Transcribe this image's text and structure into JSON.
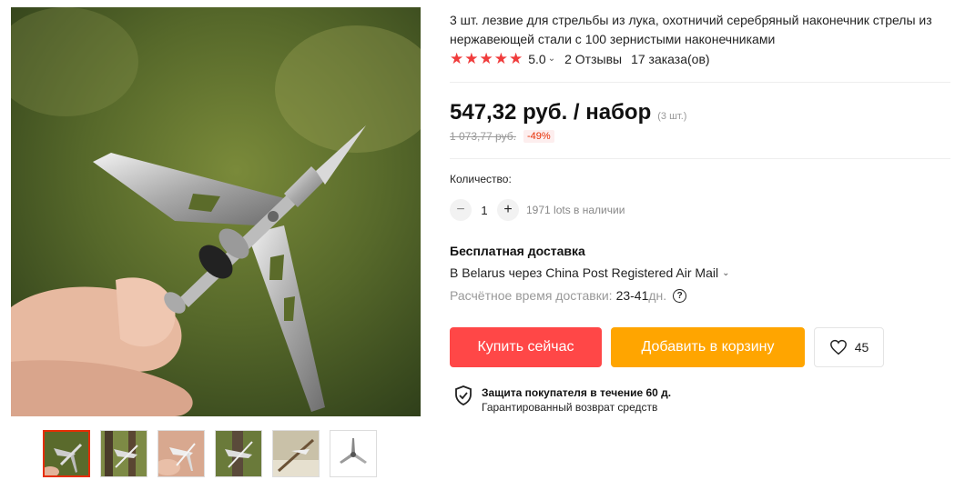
{
  "product": {
    "title": "3 шт. лезвие для стрельбы из лука, охотничий серебряный наконечник стрелы из нержавеющей стали с 100 зернистыми наконечниками",
    "rating": "5.0",
    "reviews": "2 Отзывы",
    "orders": "17 заказа(ов)"
  },
  "price": {
    "current": "547,32 руб. / набор",
    "unit_note": "(3 шт.)",
    "old": "1 073,77 руб.",
    "discount": "-49%"
  },
  "quantity": {
    "label": "Количество:",
    "value": "1",
    "minus": "−",
    "plus": "+",
    "stock": "1971 lots в наличии"
  },
  "shipping": {
    "title": "Бесплатная доставка",
    "method": "В Belarus через China Post Registered Air Mail",
    "time_label": "Расчётное время доставки:",
    "days": "23-41",
    "days_unit": "дн."
  },
  "actions": {
    "buy": "Купить сейчас",
    "cart": "Добавить в корзину",
    "wishlist_count": "45"
  },
  "protection": {
    "title": "Защита покупателя в течение 60 д.",
    "subtitle": "Гарантированный возврат средств"
  },
  "icons": {
    "star": "star-icon",
    "heart": "heart-icon",
    "shield": "shield-check-icon",
    "help": "question-icon"
  },
  "colors": {
    "star": "#f03c3c",
    "buy": "#ff4747",
    "cart": "#ffa500",
    "discount": "#e62e04"
  }
}
